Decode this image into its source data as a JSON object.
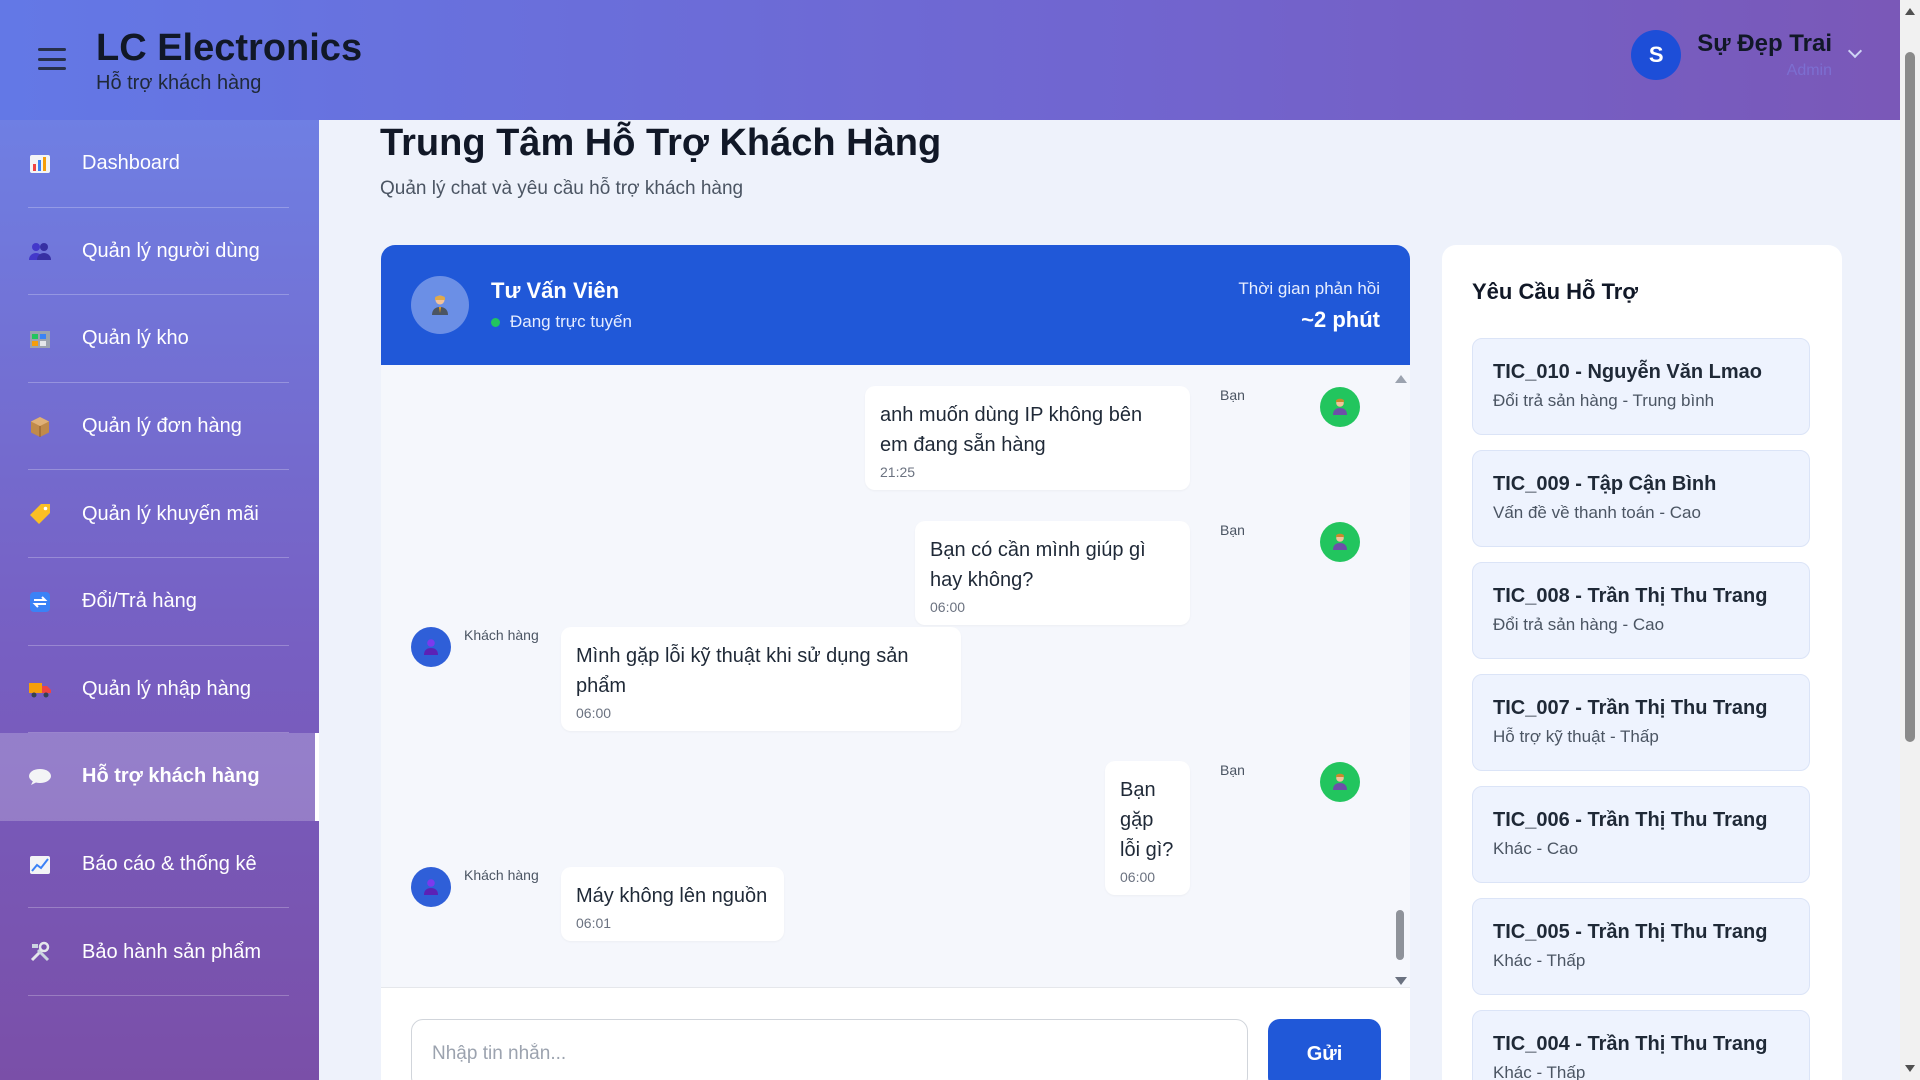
{
  "header": {
    "brand_title": "LC Electronics",
    "brand_subtitle": "Hỗ trợ khách hàng",
    "user_initial": "S",
    "user_name": "Sự Đẹp Trai",
    "user_role": "Admin"
  },
  "sidebar": {
    "items": [
      {
        "label": "Dashboard",
        "icon": "bar-chart-icon"
      },
      {
        "label": "Quản lý người dùng",
        "icon": "users-icon"
      },
      {
        "label": "Quản lý kho",
        "icon": "warehouse-icon"
      },
      {
        "label": "Quản lý đơn hàng",
        "icon": "package-icon"
      },
      {
        "label": "Quản lý khuyến mãi",
        "icon": "tag-icon"
      },
      {
        "label": "Đổi/Trả hàng",
        "icon": "return-icon"
      },
      {
        "label": "Quản lý nhập hàng",
        "icon": "truck-icon"
      },
      {
        "label": "Hỗ trợ khách hàng",
        "icon": "chat-bubble-icon",
        "active": true
      },
      {
        "label": "Báo cáo & thống kê",
        "icon": "line-chart-icon"
      },
      {
        "label": "Bảo hành sản phẩm",
        "icon": "tools-icon"
      }
    ]
  },
  "page": {
    "title": "Trung Tâm Hỗ Trợ Khách Hàng",
    "subtitle": "Quản lý chat và yêu cầu hỗ trợ khách hàng"
  },
  "chat": {
    "agent_name": "Tư Vấn Viên",
    "agent_status": "Đang trực tuyến",
    "response_label": "Thời gian phản hồi",
    "response_value": "~2 phút",
    "messages": [
      {
        "sender": "Bạn",
        "text": "anh muốn dùng IP không bên em đang sẵn hàng",
        "time": "21:25"
      },
      {
        "sender": "Bạn",
        "text": "Bạn có cần mình giúp gì hay không?",
        "time": "06:00"
      },
      {
        "sender": "Khách hàng",
        "text": "Mình gặp lỗi kỹ thuật khi sử dụng sản phẩm",
        "time": "06:00"
      },
      {
        "sender": "Bạn",
        "text": "Bạn gặp lỗi gì?",
        "time": "06:00"
      },
      {
        "sender": "Khách hàng",
        "text": "Máy không lên nguồn",
        "time": "06:01"
      }
    ],
    "input_placeholder": "Nhập tin nhắn...",
    "send_label": "Gửi"
  },
  "requests": {
    "title": "Yêu Cầu Hỗ Trợ",
    "tickets": [
      {
        "title": "TIC_010 - Nguyễn Văn Lmao",
        "sub": "Đổi trả sản hàng - Trung bình"
      },
      {
        "title": "TIC_009 - Tập Cận Bình",
        "sub": "Vấn đề về thanh toán - Cao"
      },
      {
        "title": "TIC_008 - Trần Thị Thu Trang",
        "sub": "Đổi trả sản hàng - Cao"
      },
      {
        "title": "TIC_007 - Trần Thị Thu Trang",
        "sub": "Hỗ trợ kỹ thuật - Thấp"
      },
      {
        "title": "TIC_006 - Trần Thị Thu Trang",
        "sub": "Khác - Cao"
      },
      {
        "title": "TIC_005 - Trần Thị Thu Trang",
        "sub": "Khác - Thấp"
      },
      {
        "title": "TIC_004 - Trần Thị Thu Trang",
        "sub": "Khác - Thấp"
      }
    ]
  },
  "colors": {
    "accent": "#2058d8",
    "online": "#22c55e",
    "header_start": "#6378e6",
    "header_end": "#7a58b8"
  }
}
